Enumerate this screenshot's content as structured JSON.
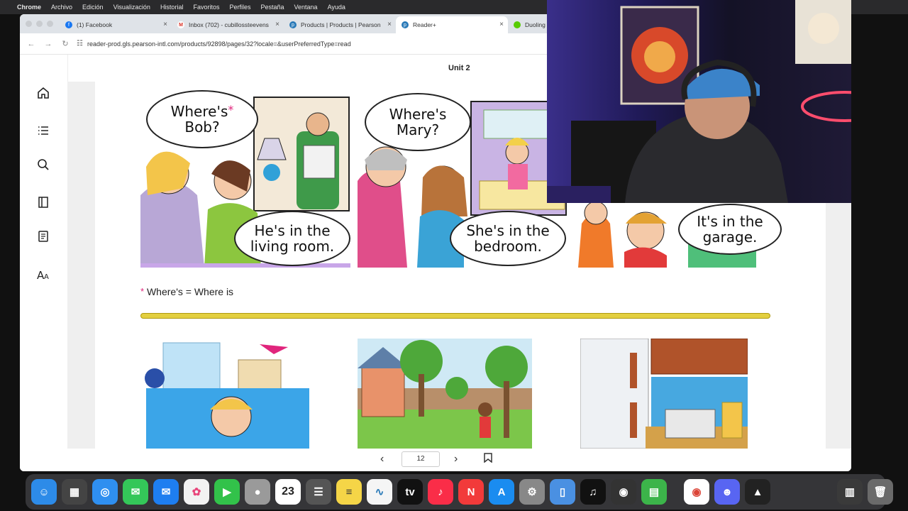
{
  "menubar": {
    "app": "Chrome",
    "items": [
      "Archivo",
      "Edición",
      "Visualización",
      "Historial",
      "Favoritos",
      "Perfiles",
      "Pestaña",
      "Ventana",
      "Ayuda"
    ]
  },
  "browser": {
    "tabs": [
      {
        "title": "(1) Facebook",
        "favicon": "facebook-icon",
        "color": "#1877f2"
      },
      {
        "title": "Inbox (702) - cubillossteevens",
        "favicon": "gmail-icon",
        "color": "#d93025"
      },
      {
        "title": "Products | Products | Pearson",
        "favicon": "pearson-icon",
        "color": "#2a7ab8"
      },
      {
        "title": "Reader+",
        "favicon": "pearson-icon",
        "color": "#2a7ab8",
        "active": true
      },
      {
        "title": "Duoling",
        "favicon": "duolingo-icon",
        "color": "#58cc02"
      }
    ],
    "url": "reader-prod.gls.pearson-intl.com/products/92898/pages/32?locale=&userPreferredType=read"
  },
  "reader": {
    "sidebar_icons": [
      "home-icon",
      "contents-icon",
      "search-icon",
      "page-view-icon",
      "notebook-icon",
      "text-size-icon"
    ],
    "unit_title": "Unit 2",
    "panels": [
      {
        "question": "Where's",
        "question2": "Bob?",
        "answer": "He's in the living room."
      },
      {
        "question": "Where's",
        "question2": "Mary?",
        "answer": "She's in the bedroom."
      },
      {
        "answer": "It's in the garage."
      }
    ],
    "star": "*",
    "footnote": "Where's = Where is",
    "page_number": "12"
  },
  "dock": {
    "calendar_day": "23"
  },
  "colors": {
    "accent_pink": "#e0257c",
    "gold_bar": "#e3cf3f"
  }
}
